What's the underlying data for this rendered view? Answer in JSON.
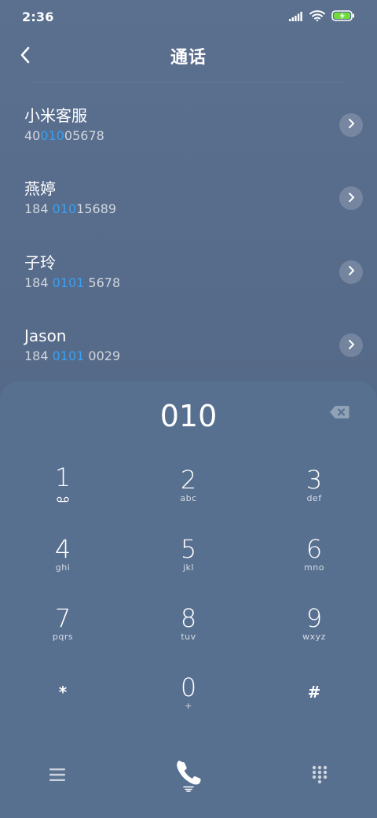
{
  "status_bar": {
    "time": "2:36",
    "icons": [
      "signal-icon",
      "wifi-icon",
      "battery-charging-icon"
    ],
    "battery_color": "#6fdc3c"
  },
  "header": {
    "title": "通话",
    "back_icon": "back-arrow-icon"
  },
  "results": [
    {
      "name": "小米客服",
      "number_parts": [
        "40",
        "010",
        "05678"
      ]
    },
    {
      "name": "燕婷",
      "number_parts": [
        "184 ",
        "010",
        "15689"
      ]
    },
    {
      "name": "子玲",
      "number_parts": [
        "184 ",
        "0101",
        " 5678"
      ]
    },
    {
      "name": "Jason",
      "number_parts": [
        "184 ",
        "0101",
        " 0029"
      ]
    }
  ],
  "dialpad": {
    "input_value": "010",
    "backspace_icon": "backspace-icon",
    "keys": [
      {
        "digit": "1",
        "letters": "",
        "icon": "voicemail-icon"
      },
      {
        "digit": "2",
        "letters": "abc"
      },
      {
        "digit": "3",
        "letters": "def"
      },
      {
        "digit": "4",
        "letters": "ghi"
      },
      {
        "digit": "5",
        "letters": "jkl"
      },
      {
        "digit": "6",
        "letters": "mno"
      },
      {
        "digit": "7",
        "letters": "pqrs"
      },
      {
        "digit": "8",
        "letters": "tuv"
      },
      {
        "digit": "9",
        "letters": "wxyz"
      },
      {
        "digit": "*",
        "letters": ""
      },
      {
        "digit": "0",
        "letters": "+"
      },
      {
        "digit": "#",
        "letters": ""
      }
    ]
  },
  "bottom_bar": {
    "menu_icon": "menu-icon",
    "call_icon": "phone-call-icon",
    "keypad_icon": "keypad-icon"
  },
  "colors": {
    "highlight": "#3aa0f0",
    "background": "#566a89",
    "dialpad_bg": "#587090"
  }
}
